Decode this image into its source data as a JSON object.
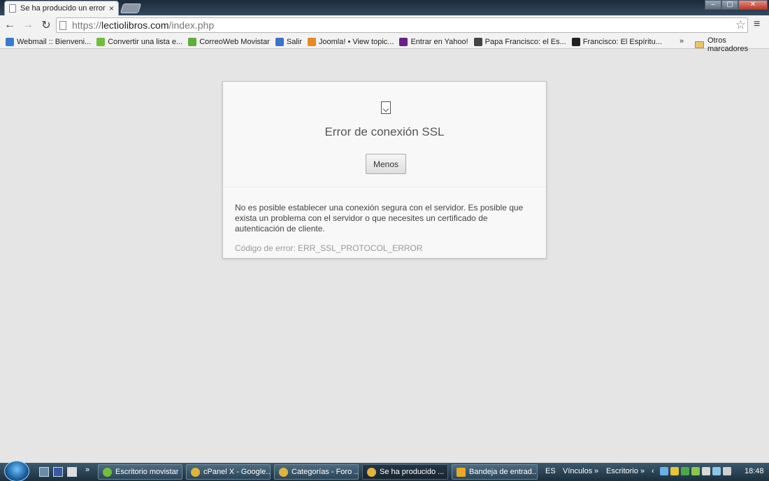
{
  "browser": {
    "tab_title": "Se ha producido un error d",
    "tab_close": "×",
    "url_scheme": "https://",
    "url_host": "lectiolibros.com",
    "url_path": "/index.php",
    "back_icon": "←",
    "forward_icon": "→",
    "reload_icon": "↻",
    "star_icon": "☆",
    "menu_icon": "≡",
    "min_icon": "‒",
    "max_icon": "▢",
    "close_icon": "✕"
  },
  "bookmarks": {
    "items": [
      {
        "label": "Webmail :: Bienveni...",
        "icon": "webmail-icon",
        "color": "#3a7bc8"
      },
      {
        "label": "Convertir una lista e...",
        "icon": "et-icon",
        "color": "#6fbf3b"
      },
      {
        "label": "CorreoWeb Movistar",
        "icon": "movistar-icon",
        "color": "#5fae3a"
      },
      {
        "label": "Salir",
        "icon": "google-icon",
        "color": "#3b73c9"
      },
      {
        "label": "Joomla! • View topic...",
        "icon": "joomla-icon",
        "color": "#e88a24"
      },
      {
        "label": "Entrar en Yahoo!",
        "icon": "yahoo-icon",
        "color": "#6b1e8a"
      },
      {
        "label": "Papa Francisco: el Es...",
        "icon": "rel-icon",
        "color": "#444444"
      },
      {
        "label": "Francisco: El Espíritu...",
        "icon": "l-icon",
        "color": "#222222"
      }
    ],
    "more": "»",
    "other_label": "Otros marcadores"
  },
  "error_page": {
    "title": "Error de conexión SSL",
    "less_button": "Menos",
    "details": "No es posible establecer una conexión segura con el servidor. Es posible que exista un problema con el servidor o que necesites un certificado de autenticación de cliente.",
    "error_code": "Código de error: ERR_SSL_PROTOCOL_ERROR"
  },
  "taskbar": {
    "quick_more": "»",
    "buttons": [
      {
        "label": "Escritorio movistar",
        "icon_color": "#6fbf3b"
      },
      {
        "label": "cPanel X - Google...",
        "icon_color": "#e0b43a"
      },
      {
        "label": "Categorías - Foro ...",
        "icon_color": "#e0b43a"
      },
      {
        "label": "Se ha producido ...",
        "icon_color": "#e0b43a"
      },
      {
        "label": "Bandeja de entrad...",
        "icon_color": "#e8a82a"
      }
    ],
    "lang": "ES",
    "links": "Vínculos",
    "links_more": "»",
    "desktop": "Escritorio",
    "desktop_more": "»",
    "tray_arrow": "‹",
    "clock": "18:48"
  }
}
